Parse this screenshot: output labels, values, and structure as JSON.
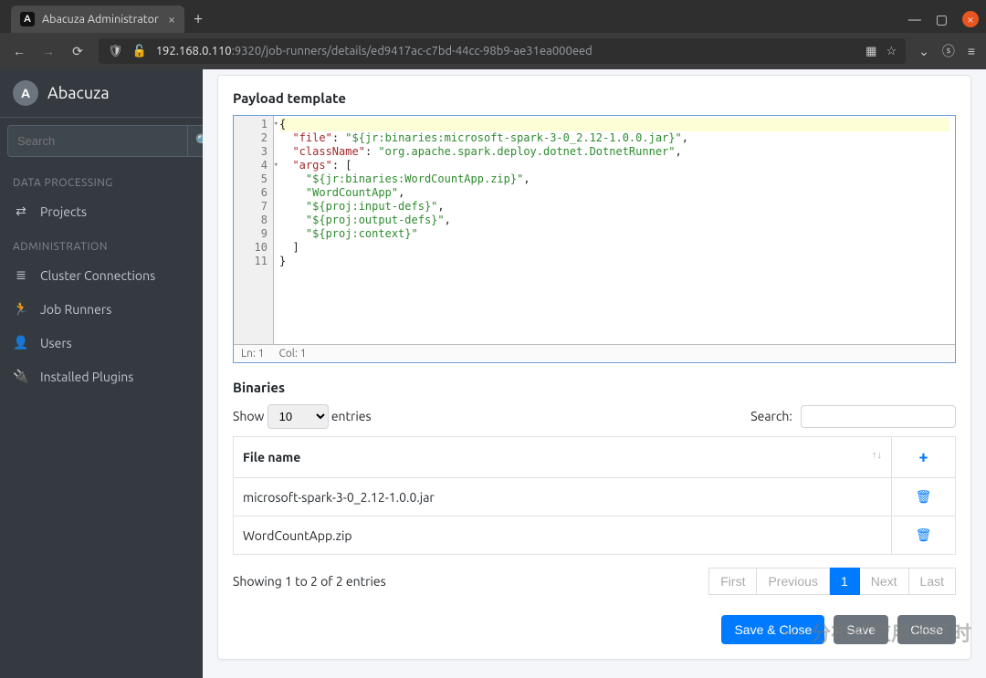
{
  "browser": {
    "tab_title": "Abacuza Administrator",
    "url_host": "192.168.0.110",
    "url_path": ":9320/job-runners/details/ed9417ac-c7bd-44cc-98b9-ae31ea000eed"
  },
  "brand": {
    "name": "Abacuza",
    "logo_letter": "A"
  },
  "sidebar": {
    "search_placeholder": "Search",
    "sections": [
      {
        "heading": "DATA PROCESSING",
        "items": [
          {
            "icon": "share-icon",
            "glyph": "⇄",
            "label": "Projects"
          }
        ]
      },
      {
        "heading": "ADMINISTRATION",
        "items": [
          {
            "icon": "stack-icon",
            "glyph": "≣",
            "label": "Cluster Connections"
          },
          {
            "icon": "runner-icon",
            "glyph": "🏃",
            "label": "Job Runners"
          },
          {
            "icon": "user-icon",
            "glyph": "👤",
            "label": "Users"
          },
          {
            "icon": "plug-icon",
            "glyph": "🔌",
            "label": "Installed Plugins"
          }
        ]
      }
    ]
  },
  "payload": {
    "title": "Payload template",
    "lines": [
      "{",
      "  \"file\": \"${jr:binaries:microsoft-spark-3-0_2.12-1.0.0.jar}\",",
      "  \"className\": \"org.apache.spark.deploy.dotnet.DotnetRunner\",",
      "  \"args\": [",
      "    \"${jr:binaries:WordCountApp.zip}\",",
      "    \"WordCountApp\",",
      "    \"${proj:input-defs}\",",
      "    \"${proj:output-defs}\",",
      "    \"${proj:context}\"",
      "  ]",
      "}"
    ],
    "fold_lines": [
      1,
      4
    ],
    "status_line": "Ln: 1",
    "status_col": "Col: 1"
  },
  "binaries": {
    "title": "Binaries",
    "show_label_pre": "Show",
    "show_label_post": "entries",
    "show_value": "10",
    "search_label": "Search:",
    "column_header": "File name",
    "rows": [
      {
        "name": "microsoft-spark-3-0_2.12-1.0.0.jar"
      },
      {
        "name": "WordCountApp.zip"
      }
    ],
    "info": "Showing 1 to 2 of 2 entries",
    "pager": {
      "first": "First",
      "prev": "Previous",
      "page": "1",
      "next": "Next",
      "last": "Last"
    }
  },
  "footer": {
    "save_close": "Save & Close",
    "save": "Save",
    "close": "Close"
  },
  "watermark": "分布式应用运行时"
}
